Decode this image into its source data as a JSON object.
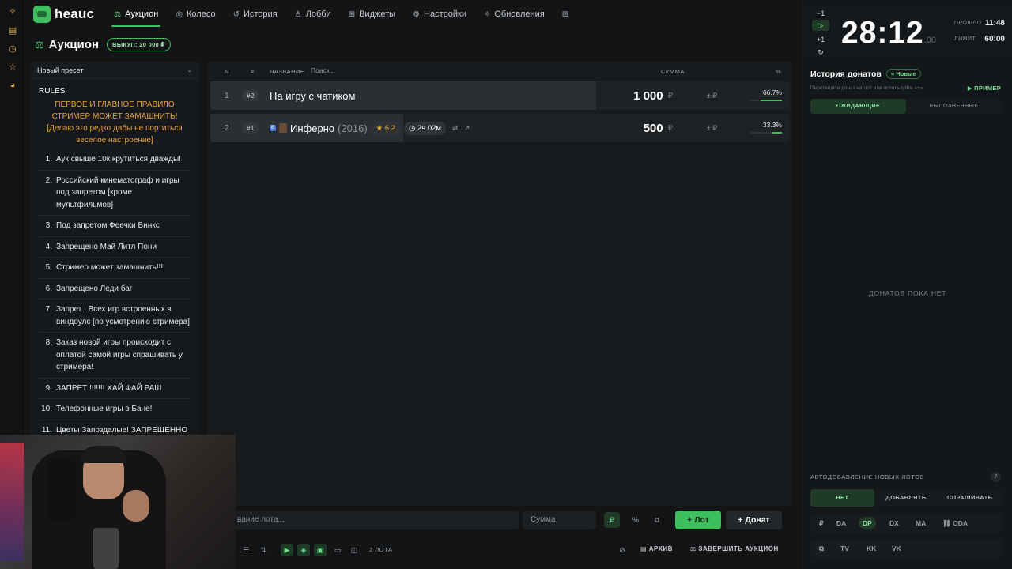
{
  "app": {
    "logo_text": "heauc"
  },
  "nav": [
    {
      "label": "Аукцион",
      "icon": "gavel-icon",
      "glyph": "⚖",
      "active": true
    },
    {
      "label": "Колесо",
      "icon": "wheel-icon",
      "glyph": "◎"
    },
    {
      "label": "История",
      "icon": "history-icon",
      "glyph": "↺"
    },
    {
      "label": "Лобби",
      "icon": "users-icon",
      "glyph": "♙"
    },
    {
      "label": "Виджеты",
      "icon": "widgets-icon",
      "glyph": "⊞"
    },
    {
      "label": "Настройки",
      "icon": "gear-icon",
      "glyph": "⚙"
    },
    {
      "label": "Обновления",
      "icon": "sparkle-icon",
      "glyph": "✧"
    }
  ],
  "header": {
    "title": "Аукцион",
    "buyout": "ВЫКУП: 20 000 ₽"
  },
  "rules_panel": {
    "preset": "Новый пресет",
    "heading": "RULES",
    "warning_line1": "ПЕРВОЕ И ГЛАВНОЕ ПРАВИЛО СТРИМЕР МОЖЕТ ЗАМАШНИТЬ!",
    "warning_line2": "[Делаю это редко дабы не портиться веселое настроение]",
    "items": [
      {
        "num": "1.",
        "text": "Аук свыше 10к крутиться дважды!"
      },
      {
        "num": "2.",
        "text": "Российский кинематограф и игры под запретом [кроме мультфильмов]"
      },
      {
        "num": "3.",
        "text": "Под запретом Феечки Винкс"
      },
      {
        "num": "4.",
        "text": "Запрещено Май Литл Пони"
      },
      {
        "num": "5.",
        "text": "Стример может замашнить!!!!"
      },
      {
        "num": "6.",
        "text": "Запрещено Леди баг"
      },
      {
        "num": "7.",
        "text": "Запрет | Всех игр встроенных в виндоулс [по усмотрению стримера]"
      },
      {
        "num": "8.",
        "text": "Заказ новой игры происходит с оплатой самой игры спрашивать у стримера!"
      },
      {
        "num": "9.",
        "text": "ЗАПРЕТ !!!!!!! ХАЙ ФАЙ РАШ"
      },
      {
        "num": "10.",
        "text": "Телефонные игры в Бане!"
      },
      {
        "num": "11.",
        "text": "Цветы Запоздалые! ЗАПРЕЩЕННО"
      }
    ]
  },
  "table": {
    "headers": {
      "n": "N",
      "hash": "#",
      "name": "НАЗВАНИЕ",
      "search_placeholder": "Поиск...",
      "sum": "СУММА",
      "pct": "%"
    },
    "lots": [
      {
        "n": "1",
        "id": "#2",
        "name": "На игру с чатиком",
        "amount": "1 000",
        "currency": "₽",
        "pm": "± ₽",
        "pct": "66.7%",
        "share": 0.667
      },
      {
        "n": "2",
        "id": "#1",
        "name": "Инферно",
        "year": "(2016)",
        "rating": "★ 6.2",
        "duration": "◷ 2ч 02м",
        "amount": "500",
        "currency": "₽",
        "pm": "± ₽",
        "pct": "33.3%",
        "share": 0.333
      }
    ]
  },
  "addbar": {
    "name_placeholder": "вание лота...",
    "sum_placeholder": "Сумма",
    "mode_rub": "₽",
    "mode_pct": "%",
    "add_lot": "+ Лот",
    "add_donation": "+ Донат"
  },
  "statusbar": {
    "lots_count": "2 ЛОТА",
    "archive": "АРХИВ",
    "finish": "ЗАВЕРШИТЬ АУКЦИОН"
  },
  "timer": {
    "minus": "−1",
    "plus": "+1",
    "value": "28:12",
    "ms": ".00",
    "elapsed_label": "ПРОШЛО",
    "elapsed": "11:48",
    "limit_label": "ЛИМИТ",
    "limit": "60:00"
  },
  "donations": {
    "title": "История донатов",
    "new_badge": "≡ Новые",
    "hint": "Перетащите донат на лот или используйте «+»",
    "example": "▶ ПРИМЕР",
    "tab_waiting": "ОЖИДАЮЩИЕ",
    "tab_done": "ВЫПОЛНЕННЫЕ",
    "empty": "ДОНАТОВ ПОКА НЕТ"
  },
  "auto_add": {
    "title": "АВТОДОБАВЛЕНИЕ НОВЫХ ЛОТОВ",
    "help": "?",
    "opt_no": "НЕТ",
    "opt_add": "ДОБАВЛЯТЬ",
    "opt_ask": "СПРАШИВАТЬ"
  },
  "services_row1": [
    "₽",
    "DA",
    "DP",
    "DX",
    "MA",
    "ODA"
  ],
  "services_row2": [
    "⧉",
    "TV",
    "KK",
    "VK"
  ],
  "colors": {
    "accent": "#3cbf5c",
    "bg": "#121416",
    "panel": "#181b1e",
    "warning": "#e8a23c"
  }
}
